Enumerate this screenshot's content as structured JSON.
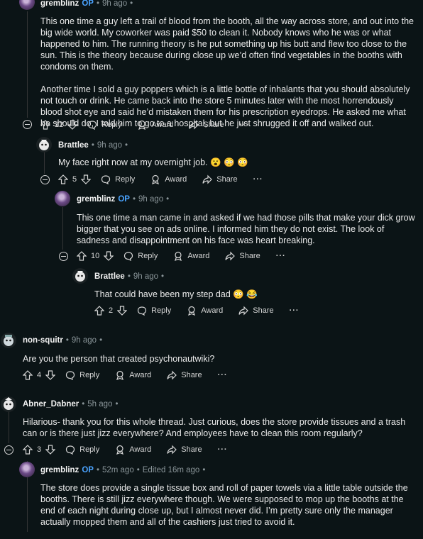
{
  "comments": [
    {
      "author": "gremblinz",
      "op": "OP",
      "time": "9h ago",
      "paragraphs": [
        "This one time a guy left a trail of blood from the booth, all the way across store, and out into the big wide world. My coworker was paid $50 to clean it. Nobody knows who he was or what happened to him. The running theory is he put something up his butt and flew too close to the sun. This is the theory because during close up we’d often find vegetables in the booths with condoms on them.",
        "Another time I sold a guy poppers which is a little bottle of inhalants that you should absolutely not touch or drink. He came back into the store 5 minutes later with the most horrendously blood shot eye and said he’d mistaken them for his prescription eyedrops. He asked me what he should do, I told him to go to a hospital, but he just shrugged it off and walked out."
      ],
      "votes": "12"
    },
    {
      "author": "Brattlee",
      "time": "9h ago",
      "text": "My face right now at my overnight job. 😮 😳 😳",
      "votes": "5"
    },
    {
      "author": "gremblinz",
      "op": "OP",
      "time": "9h ago",
      "text": "This one time a man came in and asked if we had those pills that make your dick grow bigger that you see on ads online. I informed him they do not exist. The look of sadness and disappointment on his face was heart breaking.",
      "votes": "10"
    },
    {
      "author": "Brattlee",
      "time": "9h ago",
      "text": "That could have been my step dad 😳 😂",
      "votes": "2"
    },
    {
      "author": "non-squitr",
      "time": "9h ago",
      "text": "Are you the person that created psychonautwiki?",
      "votes": "4"
    },
    {
      "author": "Abner_Dabner",
      "time": "5h ago",
      "text": "Hilarious- thank you for this whole thread. Just curious, does the store provide tissues and a trash can or is there just jizz everywhere? And employees have to clean this room regularly?",
      "votes": "3"
    },
    {
      "author": "gremblinz",
      "op": "OP",
      "time": "52m ago",
      "edited": "Edited 16m ago",
      "text": "The store does provide a single tissue box and roll of paper towels via a little table outside the booths. There is still jizz everywhere though. We were supposed to mop up the booths at the end of each night during close up, but I almost never did. I’m pretty sure only the manager actually mopped them and all of the cashiers just tried to avoid it."
    }
  ],
  "labels": {
    "reply": "Reply",
    "award": "Award",
    "share": "Share",
    "more": "···",
    "dot": "•"
  },
  "colors": {
    "background": "#0b1416",
    "op": "#4aa3ff",
    "thread_line": "#343536"
  }
}
